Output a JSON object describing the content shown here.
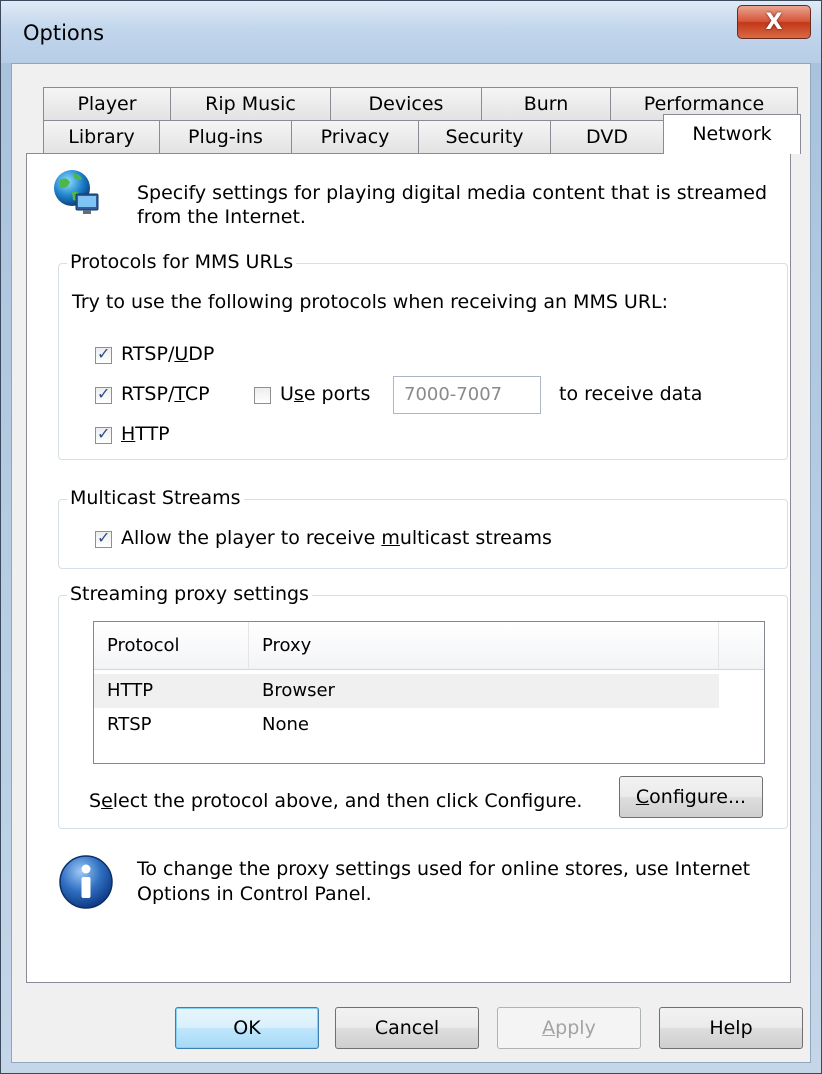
{
  "window": {
    "title": "Options",
    "close_glyph": "X"
  },
  "tabs_row1": [
    "Player",
    "Rip Music",
    "Devices",
    "Burn",
    "Performance"
  ],
  "tabs_row2": [
    "Library",
    "Plug-ins",
    "Privacy",
    "Security",
    "DVD",
    "Network"
  ],
  "active_tab": "Network",
  "intro": {
    "line1": "Specify settings for playing digital media content that is streamed",
    "line2": "from the Internet.",
    "icon": "globe-network-icon"
  },
  "protocols": {
    "legend": "Protocols for MMS URLs",
    "instruction": "Try to use the following protocols when receiving an MMS URL:",
    "rtsp_udp": {
      "label_pre": "RTSP/",
      "label_u": "U",
      "label_post": "DP",
      "checked": true
    },
    "rtsp_tcp": {
      "label_pre": "RTSP/",
      "label_u": "T",
      "label_post": "CP",
      "checked": true
    },
    "use_ports": {
      "label_pre": "U",
      "label_u": "s",
      "label_post": "e ports",
      "checked": false,
      "value": "7000-7007",
      "suffix": "to receive data"
    },
    "http": {
      "label_pre": "",
      "label_u": "H",
      "label_post": "TTP",
      "checked": true
    }
  },
  "multicast": {
    "legend": "Multicast Streams",
    "allow": {
      "label_pre": "Allow the player to receive ",
      "label_u": "m",
      "label_post": "ulticast streams",
      "checked": true
    }
  },
  "proxy": {
    "legend": "Streaming proxy settings",
    "columns": [
      "Protocol",
      "Proxy"
    ],
    "rows": [
      {
        "protocol": "HTTP",
        "proxy": "Browser"
      },
      {
        "protocol": "RTSP",
        "proxy": "None"
      }
    ],
    "hint_pre": "S",
    "hint_u": "e",
    "hint_post": "lect the protocol above, and then click Configure.",
    "configure_u": "C",
    "configure_post": "onfigure..."
  },
  "note": {
    "line1": "To change the proxy settings used for online stores, use Internet",
    "line2": "Options in Control Panel.",
    "icon": "info-icon"
  },
  "buttons": {
    "ok": "OK",
    "cancel": "Cancel",
    "apply_u": "A",
    "apply_post": "pply",
    "help": "Help"
  }
}
